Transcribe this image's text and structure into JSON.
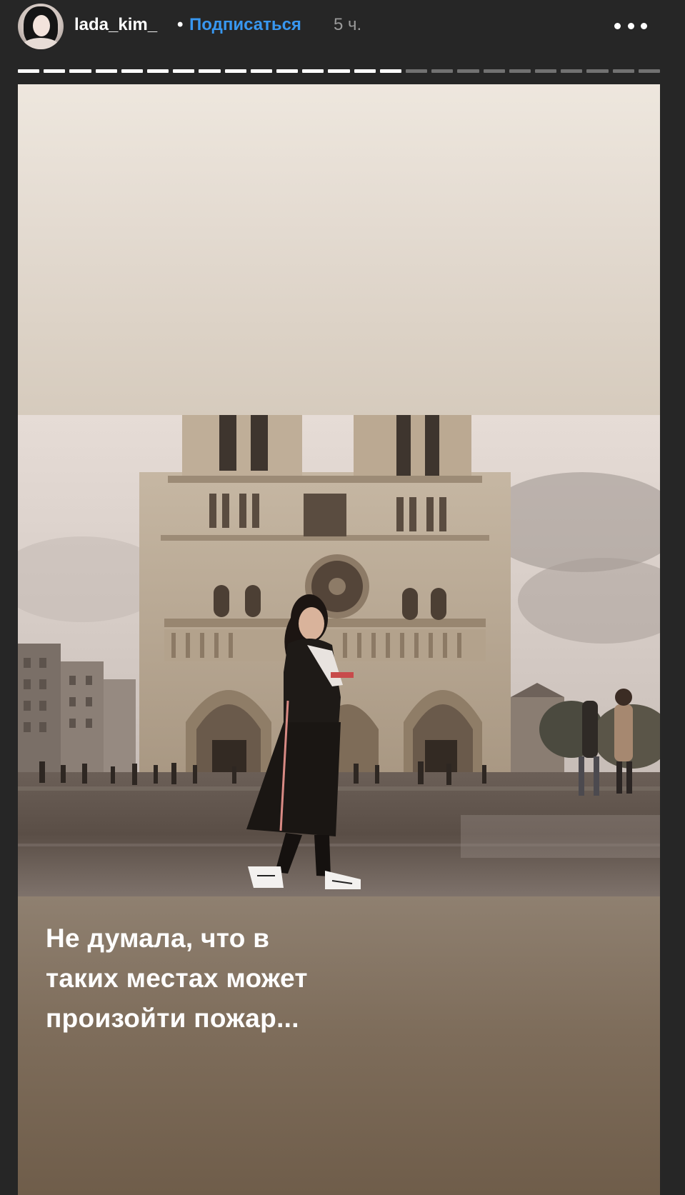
{
  "header": {
    "username": "lada_kim_",
    "separator": "•",
    "follow_label": "Подписаться",
    "time_ago": "5 ч."
  },
  "progress": {
    "segments_total": 25,
    "segments_viewed": 15
  },
  "story": {
    "caption_lines": [
      "Не думала, что в",
      "таких местах может",
      "произойти  пожар..."
    ]
  },
  "icons": {
    "avatar": "profile-photo",
    "more": "more-options-icon"
  },
  "colors": {
    "background": "#262626",
    "follow_link": "#3897f0",
    "caption_text": "#ffffff"
  }
}
